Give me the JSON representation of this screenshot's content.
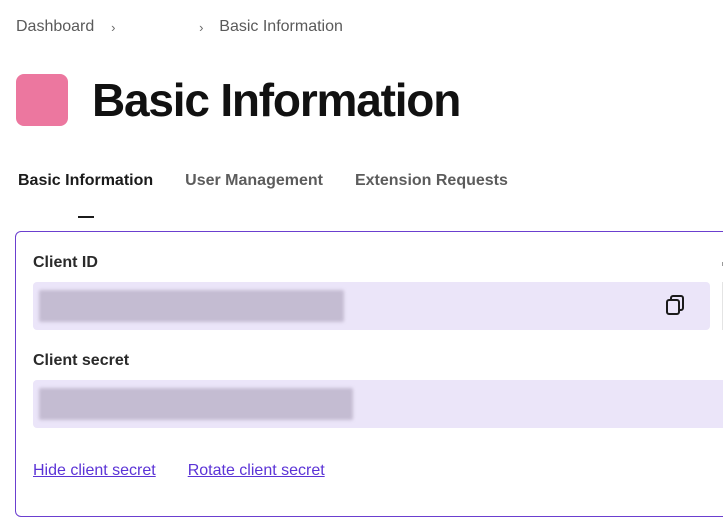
{
  "breadcrumb": {
    "items": [
      "Dashboard",
      "",
      "Basic Information"
    ],
    "separator": "›"
  },
  "header": {
    "title": "Basic Information",
    "logo_color": "#ec779f"
  },
  "tabs": [
    {
      "label": "Basic Information",
      "active": true
    },
    {
      "label": "User Management",
      "active": false
    },
    {
      "label": "Extension Requests",
      "active": false
    }
  ],
  "credentials": {
    "client_id_label": "Client ID",
    "client_secret_label": "Client secret",
    "client_id_value": "",
    "client_secret_value": "",
    "copy_icon": "copy-icon"
  },
  "actions": {
    "hide_secret": "Hide client secret",
    "rotate_secret": "Rotate client secret"
  },
  "colors": {
    "accent": "#6b3fcf",
    "link": "#5b33d6",
    "field_bg": "#ebe5f9"
  }
}
